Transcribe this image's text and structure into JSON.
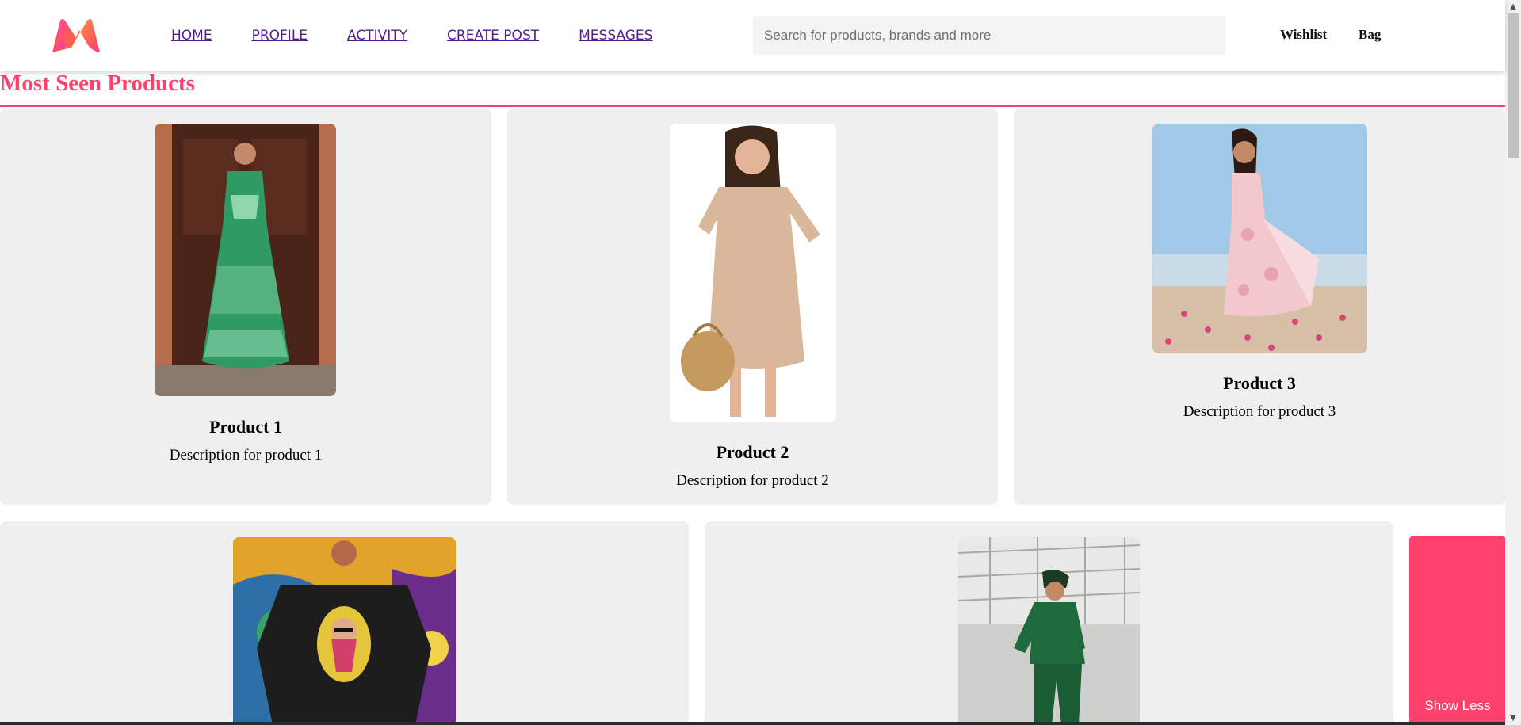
{
  "brand": {
    "logo_icon": "myntra-logo-icon",
    "accent": "#ff3f6c"
  },
  "nav": {
    "home": "HOME",
    "profile": "PROFILE",
    "activity": "ACTIVITY",
    "create_post": "CREATE POST",
    "messages": "MESSAGES"
  },
  "search": {
    "placeholder": "Search for products, brands and more",
    "value": ""
  },
  "header_links": {
    "wishlist": "Wishlist",
    "bag": "Bag"
  },
  "section": {
    "title": "Most Seen Products"
  },
  "products": [
    {
      "name": "Product 1",
      "description": "Description for product 1",
      "image": "green-floral-maxi-dress-photo"
    },
    {
      "name": "Product 2",
      "description": "Description for product 2",
      "image": "beige-floral-mini-dress-photo"
    },
    {
      "name": "Product 3",
      "description": "Description for product 3",
      "image": "pink-floral-beach-dress-photo"
    },
    {
      "image": "black-graphic-tshirt-photo"
    },
    {
      "image": "green-tracksuit-photo"
    }
  ],
  "show_less": "Show Less"
}
